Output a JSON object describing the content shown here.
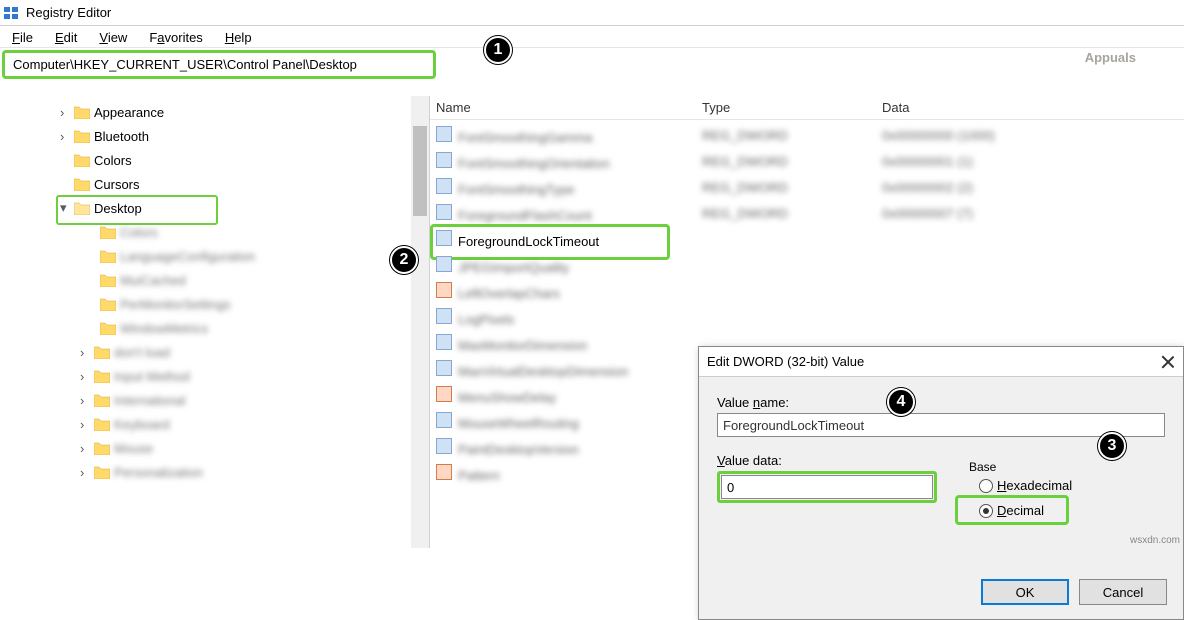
{
  "window": {
    "title": "Registry Editor"
  },
  "menus": {
    "file": "File",
    "edit": "Edit",
    "view": "View",
    "favorites": "Favorites",
    "help": "Help"
  },
  "address": {
    "path": "Computer\\HKEY_CURRENT_USER\\Control Panel\\Desktop"
  },
  "tree": {
    "parents": [
      {
        "label": "Appearance",
        "arrow": ">"
      },
      {
        "label": "Bluetooth",
        "arrow": ">"
      },
      {
        "label": "Colors",
        "arrow": ""
      },
      {
        "label": "Cursors",
        "arrow": ""
      },
      {
        "label": "Desktop",
        "arrow": "v",
        "open": true
      }
    ],
    "children": [
      "Colors",
      "LanguageConfiguration",
      "MuiCached",
      "PerMonitorSettings",
      "WindowMetrics"
    ],
    "rest": [
      "don't load",
      "Input Method",
      "International",
      "Keyboard",
      "Mouse",
      "Personalization"
    ]
  },
  "list": {
    "cols": {
      "name": "Name",
      "type": "Type",
      "data": "Data"
    },
    "rows": [
      {
        "icon": "dword",
        "name": "FontSmoothingGamma",
        "type": "REG_DWORD",
        "data": "0x00000000 (1000)"
      },
      {
        "icon": "dword",
        "name": "FontSmoothingOrientation",
        "type": "REG_DWORD",
        "data": "0x00000001 (1)"
      },
      {
        "icon": "dword",
        "name": "FontSmoothingType",
        "type": "REG_DWORD",
        "data": "0x00000002 (2)"
      },
      {
        "icon": "dword",
        "name": "ForegroundFlashCount",
        "type": "REG_DWORD",
        "data": "0x00000007 (7)"
      },
      {
        "icon": "dword",
        "name": "ForegroundLockTimeout",
        "type": "",
        "data": ""
      },
      {
        "icon": "dword",
        "name": "JPEGImportQuality"
      },
      {
        "icon": "str",
        "name": "LeftOverlapChars"
      },
      {
        "icon": "dword",
        "name": "LogPixels"
      },
      {
        "icon": "dword",
        "name": "MaxMonitorDimension"
      },
      {
        "icon": "dword",
        "name": "MaxVirtualDesktopDimension"
      },
      {
        "icon": "str",
        "name": "MenuShowDelay"
      },
      {
        "icon": "dword",
        "name": "MouseWheelRouting"
      },
      {
        "icon": "dword",
        "name": "PaintDesktopVersion"
      },
      {
        "icon": "str",
        "name": "Pattern"
      }
    ],
    "highlight_index": 4
  },
  "dialog": {
    "title": "Edit DWORD (32-bit) Value",
    "value_name_label": "Value name:",
    "value_name": "ForegroundLockTimeout",
    "value_data_label": "Value data:",
    "value_data": "0",
    "base_label": "Base",
    "hex_label": "Hexadecimal",
    "dec_label": "Decimal",
    "base_selected": "decimal",
    "ok": "OK",
    "cancel": "Cancel"
  },
  "annotations": {
    "one": "1",
    "two": "2",
    "three": "3",
    "four": "4"
  },
  "watermark": {
    "text": "Appuals"
  },
  "source": {
    "text": "wsxdn.com"
  }
}
